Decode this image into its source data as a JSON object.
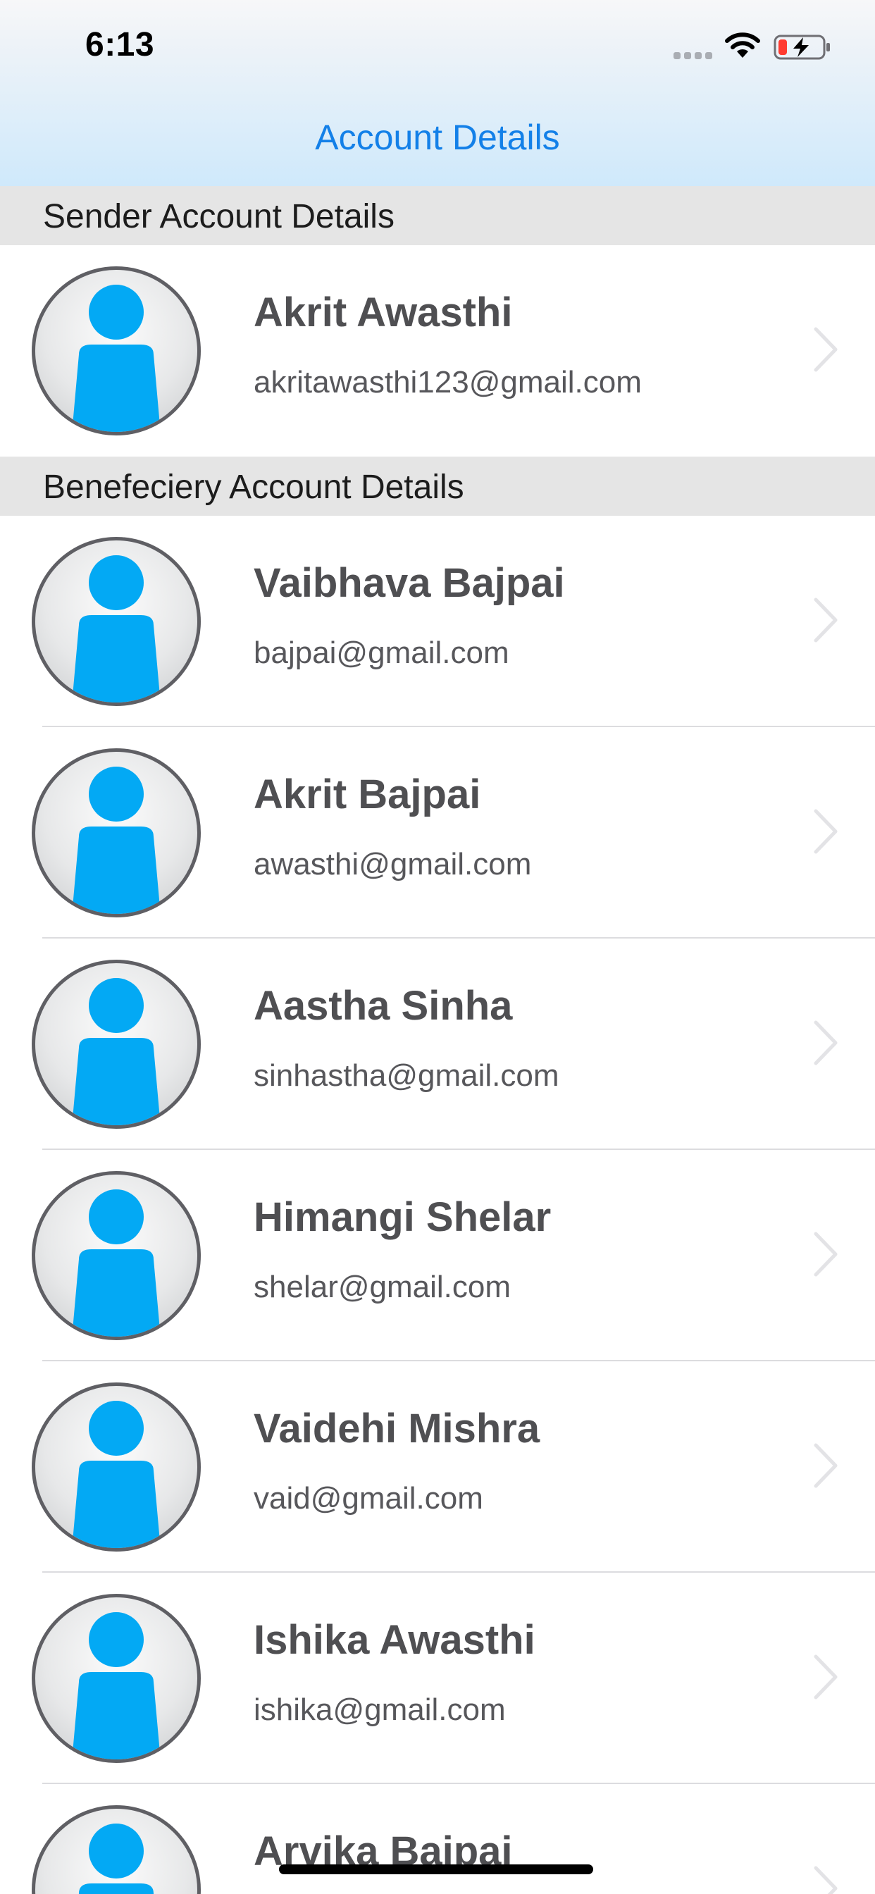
{
  "status_bar": {
    "time": "6:13",
    "icons": [
      "signal-icon",
      "wifi-icon",
      "battery-charging-icon"
    ],
    "battery_state": "low, charging"
  },
  "nav": {
    "title": "Account Details",
    "title_color": "#1380e8"
  },
  "sections": {
    "sender": {
      "header": "Sender Account Details",
      "account": {
        "name": "Akrit Awasthi",
        "email": "akritawasthi123@gmail.com"
      }
    },
    "beneficiary": {
      "header": "Benefeciery Account Details",
      "accounts": [
        {
          "name": "Vaibhava Bajpai",
          "email": "bajpai@gmail.com"
        },
        {
          "name": "Akrit Bajpai",
          "email": "awasthi@gmail.com"
        },
        {
          "name": "Aastha Sinha",
          "email": "sinhastha@gmail.com"
        },
        {
          "name": "Himangi Shelar",
          "email": "shelar@gmail.com"
        },
        {
          "name": "Vaidehi Mishra",
          "email": "vaid@gmail.com"
        },
        {
          "name": "Ishika Awasthi",
          "email": "ishika@gmail.com"
        },
        {
          "name": "Arvika Bajpai",
          "email": ""
        }
      ]
    }
  },
  "colors": {
    "avatar_person": "#03a9f4",
    "section_header_bg": "#e5e5e5",
    "name_text": "#4f4f52"
  }
}
